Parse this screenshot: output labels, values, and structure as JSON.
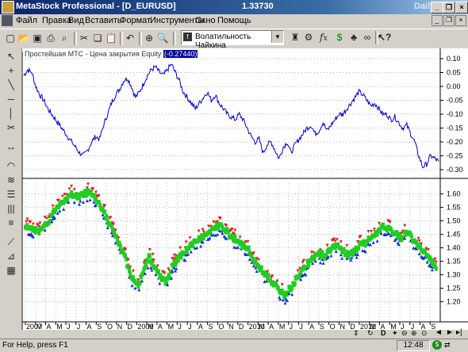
{
  "window": {
    "app_title": "MetaStock Professional - [D_EURUSD]",
    "price": "1.33730",
    "period": "Daily",
    "min_label": "_",
    "restore_label": "❐",
    "close_label": "×"
  },
  "menu": [
    "Файл",
    "Правка",
    "Вид",
    "Вставить",
    "Формат",
    "Инструменты",
    "Окно",
    "Помощь"
  ],
  "toolbar": {
    "indicator_name": "Волатильность Чайкина",
    "icons": [
      "new-icon",
      "open-icon",
      "save-icon",
      "print-icon",
      "print-preview-icon",
      "cut-icon",
      "copy-icon",
      "paste-icon",
      "undo-icon",
      "crosshair-icon",
      "zoom-icon",
      "indicator-icon",
      "expert-icon",
      "fx-icon",
      "dollar-icon",
      "binoculars-icon",
      "help-icon"
    ]
  },
  "left_tools": [
    "pointer-icon",
    "crosshair-icon",
    "trendline-icon",
    "horizontal-line-icon",
    "vertical-line-icon",
    "scissors-icon",
    "spread-icon",
    "arc-icon",
    "fan-icon",
    "channel-icon",
    "cycle-lines-icon",
    "fibonacci-icon",
    "gann-icon",
    "grid-pattern-icon"
  ],
  "chart_data": [
    {
      "type": "line",
      "title": "Простейшая МТС - Цена закрытия Equity",
      "last_value_label": "(-0.27440)",
      "ylim": [
        -0.32,
        0.12
      ],
      "y_ticks": [
        "0.10",
        "0.05",
        "0.00",
        "-0.05",
        "-0.10",
        "-0.15",
        "-0.20",
        "-0.25",
        "-0.30"
      ],
      "color": "#0000cc",
      "values": [
        0.04,
        0.06,
        0.05,
        0.0,
        -0.03,
        -0.05,
        -0.08,
        -0.1,
        -0.12,
        -0.14,
        -0.16,
        -0.18,
        -0.2,
        -0.22,
        -0.24,
        -0.25,
        -0.23,
        -0.2,
        -0.18,
        -0.19,
        -0.14,
        -0.1,
        -0.06,
        -0.03,
        -0.01,
        0.02,
        0.03,
        0.0,
        -0.04,
        -0.02,
        0.01,
        0.04,
        0.06,
        0.07,
        0.05,
        0.04,
        0.06,
        0.08,
        0.05,
        0.02,
        -0.02,
        -0.04,
        -0.06,
        -0.08,
        -0.06,
        -0.04,
        -0.02,
        -0.05,
        -0.03,
        -0.06,
        -0.08,
        -0.1,
        -0.11,
        -0.12,
        -0.1,
        -0.12,
        -0.15,
        -0.18,
        -0.2,
        -0.19,
        -0.24,
        -0.21,
        -0.2,
        -0.23,
        -0.26,
        -0.22,
        -0.2,
        -0.24,
        -0.21,
        -0.19,
        -0.17,
        -0.15,
        -0.14,
        -0.17,
        -0.16,
        -0.13,
        -0.16,
        -0.14,
        -0.12,
        -0.1,
        -0.1,
        -0.08,
        -0.06,
        -0.04,
        -0.02,
        -0.03,
        -0.05,
        -0.07,
        -0.06,
        -0.08,
        -0.1,
        -0.1,
        -0.12,
        -0.11,
        -0.13,
        -0.15,
        -0.14,
        -0.17,
        -0.2,
        -0.25,
        -0.29,
        -0.28,
        -0.25,
        -0.26,
        -0.27
      ]
    },
    {
      "type": "scatter",
      "ylim": [
        1.14,
        1.64
      ],
      "y_ticks": [
        "1.60",
        "1.55",
        "1.50",
        "1.45",
        "1.40",
        "1.35",
        "1.30",
        "1.25",
        "1.20"
      ],
      "x_labels": [
        "2007",
        "M",
        "A",
        "M",
        "J",
        "J",
        "A",
        "S",
        "O",
        "N",
        "D",
        "2009",
        "M",
        "A",
        "M",
        "J",
        "J",
        "A",
        "S",
        "O",
        "N",
        "D",
        "2010",
        "M",
        "A",
        "M",
        "J",
        "J",
        "A",
        "S",
        "O",
        "N",
        "D",
        "2011",
        "M",
        "A",
        "M",
        "J",
        "J",
        "A",
        "S"
      ],
      "series": [
        {
          "values": [
            1.47,
            1.48,
            1.46,
            1.47,
            1.5,
            1.54,
            1.57,
            1.58,
            1.6,
            1.59,
            1.6,
            1.61,
            1.58,
            1.55,
            1.5,
            1.46,
            1.41,
            1.36,
            1.3,
            1.26,
            1.3,
            1.37,
            1.33,
            1.29,
            1.27,
            1.33,
            1.36,
            1.38,
            1.41,
            1.42,
            1.44,
            1.45,
            1.47,
            1.49,
            1.47,
            1.44,
            1.43,
            1.41,
            1.39,
            1.35,
            1.32,
            1.3,
            1.27,
            1.25,
            1.22,
            1.25,
            1.28,
            1.32,
            1.34,
            1.36,
            1.38,
            1.37,
            1.4,
            1.41,
            1.39,
            1.37,
            1.39,
            1.41,
            1.42,
            1.45,
            1.46,
            1.48,
            1.47,
            1.45,
            1.44,
            1.46,
            1.43,
            1.41,
            1.38,
            1.35,
            1.33
          ]
        }
      ]
    }
  ],
  "status": {
    "help_text": "For Help, press F1",
    "time": "12:48",
    "nav_buttons": [
      "◄",
      "►"
    ],
    "bottom_icons": [
      "link-icon",
      "period-d-icon",
      "zoom-in-icon",
      "zoom-out-icon",
      "reset-icon",
      "scroll-icon"
    ]
  }
}
